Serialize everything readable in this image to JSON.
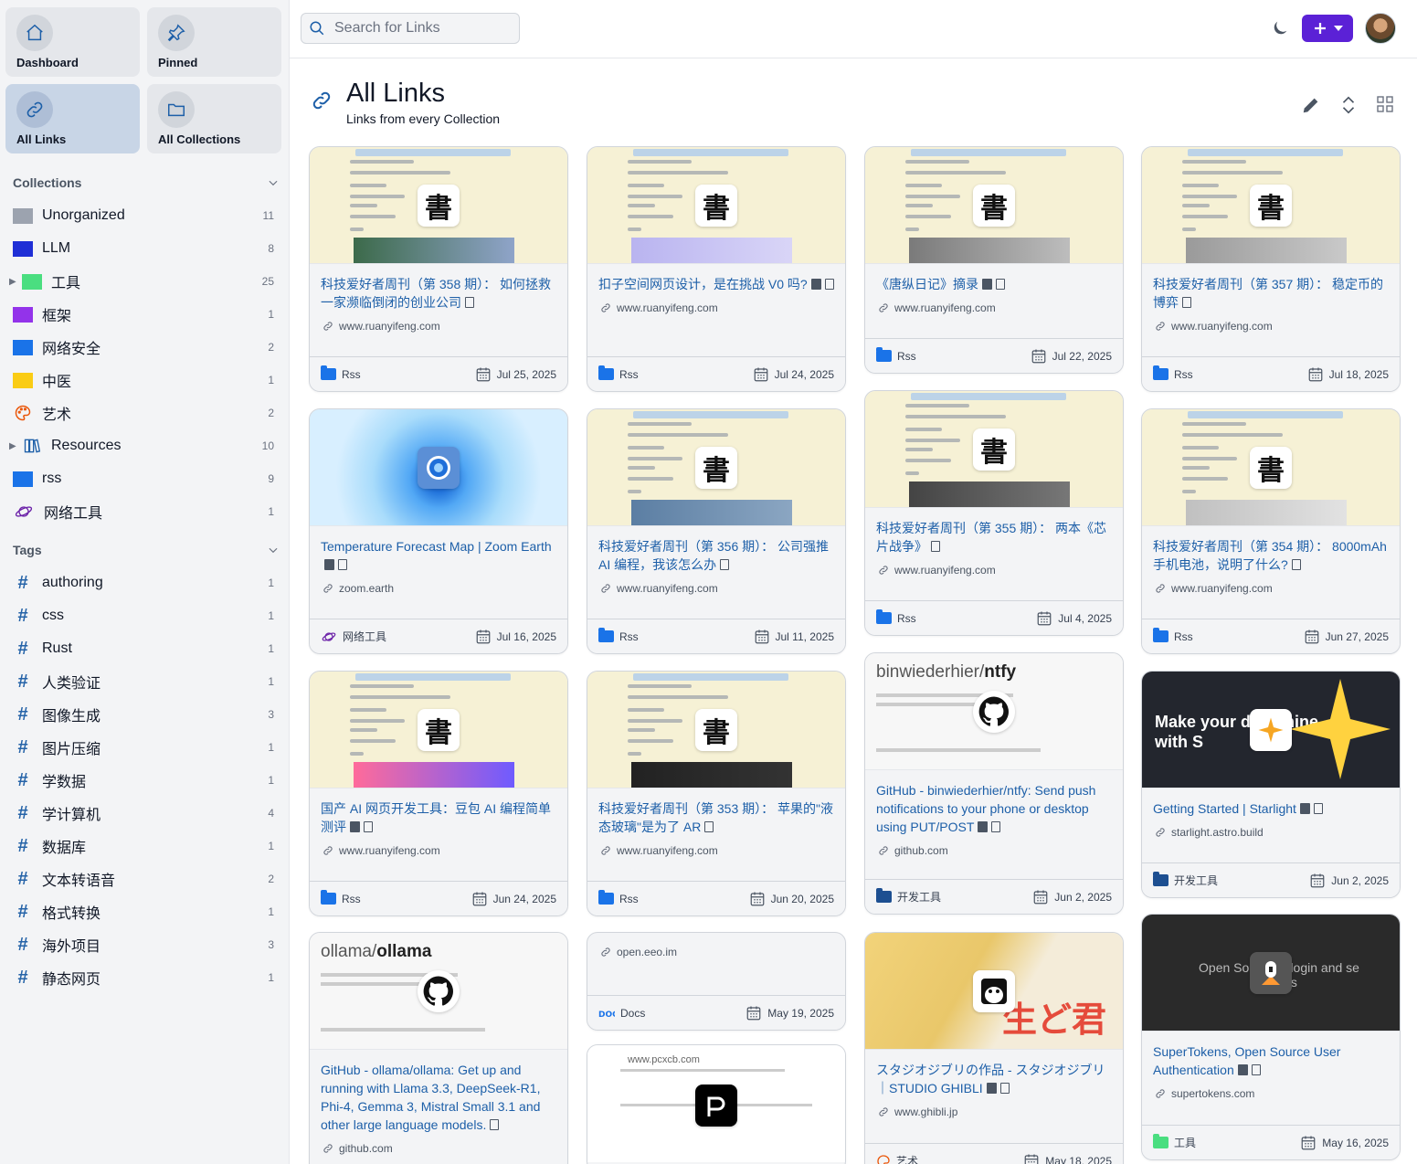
{
  "nav": [
    {
      "label": "Dashboard",
      "icon": "home-icon",
      "active": false
    },
    {
      "label": "Pinned",
      "icon": "pin-icon",
      "active": false
    },
    {
      "label": "All Links",
      "icon": "link-icon",
      "active": true
    },
    {
      "label": "All Collections",
      "icon": "folder-icon",
      "active": false
    }
  ],
  "collections": {
    "heading": "Collections",
    "items": [
      {
        "name": "Unorganized",
        "count": "11",
        "color": "#9ca3af",
        "icon": "folder-icon"
      },
      {
        "name": "LLM",
        "count": "8",
        "color": "#1f2fd6",
        "icon": "folder-icon"
      },
      {
        "name": "工具",
        "count": "25",
        "color": "#4ade80",
        "icon": "folder-icon",
        "expandable": true
      },
      {
        "name": "框架",
        "count": "1",
        "color": "#9333ea",
        "icon": "folder-icon"
      },
      {
        "name": "网络安全",
        "count": "2",
        "color": "#1a73e8",
        "icon": "folder-icon"
      },
      {
        "name": "中医",
        "count": "1",
        "color": "#facc15",
        "icon": "folder-icon"
      },
      {
        "name": "艺术",
        "count": "2",
        "color": "#ea580c",
        "icon": "palette-icon"
      },
      {
        "name": "Resources",
        "count": "10",
        "color": "#1d5fa8",
        "icon": "books-icon",
        "expandable": true
      },
      {
        "name": "rss",
        "count": "9",
        "color": "#1a73e8",
        "icon": "folder-icon"
      },
      {
        "name": "网络工具",
        "count": "1",
        "color": "#6b21a8",
        "icon": "planet-icon"
      }
    ]
  },
  "tags": {
    "heading": "Tags",
    "items": [
      {
        "name": "authoring",
        "count": "1"
      },
      {
        "name": "css",
        "count": "1"
      },
      {
        "name": "Rust",
        "count": "1"
      },
      {
        "name": "人类验证",
        "count": "1"
      },
      {
        "name": "图像生成",
        "count": "3"
      },
      {
        "name": "图片压缩",
        "count": "1"
      },
      {
        "name": "学数据",
        "count": "1"
      },
      {
        "name": "学计算机",
        "count": "4"
      },
      {
        "name": "数据库",
        "count": "1"
      },
      {
        "name": "文本转语音",
        "count": "2"
      },
      {
        "name": "格式转换",
        "count": "1"
      },
      {
        "name": "海外项目",
        "count": "3"
      },
      {
        "name": "静态网页",
        "count": "1"
      }
    ]
  },
  "search": {
    "placeholder": "Search for Links"
  },
  "header": {
    "title": "All Links",
    "subtitle": "Links from every Collection"
  },
  "colors": {
    "accent": "#5b21d6",
    "link": "#1d5fa8",
    "active_nav": "#c8d5e6"
  },
  "cards": [
    {
      "title": "科技爱好者周刊（第 358 期）： 如何拯救一家濒临倒闭的创业公司",
      "url": "www.ruanyifeng.com",
      "collection": "Rss",
      "date": "Jul 25, 2025",
      "thumb": "paper",
      "icons": [
        "doc"
      ]
    },
    {
      "title": "扣子空间网页设计，是在挑战 V0 吗?",
      "url": "www.ruanyifeng.com",
      "collection": "Rss",
      "date": "Jul 24, 2025",
      "thumb": "paper",
      "icons": [
        "img",
        "doc"
      ]
    },
    {
      "title": "《唐纵日记》摘录",
      "url": "www.ruanyifeng.com",
      "collection": "Rss",
      "date": "Jul 22, 2025",
      "thumb": "paper",
      "icons": [
        "img",
        "doc"
      ]
    },
    {
      "title": "科技爱好者周刊（第 357 期）： 稳定币的博弈",
      "url": "www.ruanyifeng.com",
      "collection": "Rss",
      "date": "Jul 18, 2025",
      "thumb": "paper",
      "icons": [
        "doc"
      ]
    },
    {
      "title": "Temperature Forecast Map | Zoom Earth",
      "url": "zoom.earth",
      "collection": "网络工具",
      "date": "Jul 16, 2025",
      "thumb": "zoom",
      "icons": [
        "img",
        "doc"
      ]
    },
    {
      "title": "科技爱好者周刊（第 356 期）： 公司强推 AI 编程，我该怎么办",
      "url": "www.ruanyifeng.com",
      "collection": "Rss",
      "date": "Jul 11, 2025",
      "thumb": "paper",
      "icons": [
        "doc"
      ]
    },
    {
      "title": "科技爱好者周刊（第 355 期）： 两本《芯片战争》",
      "url": "www.ruanyifeng.com",
      "collection": "Rss",
      "date": "Jul 4, 2025",
      "thumb": "paper",
      "icons": [
        "doc"
      ]
    },
    {
      "title": "科技爱好者周刊（第 354 期）： 8000mAh 手机电池，说明了什么?",
      "url": "www.ruanyifeng.com",
      "collection": "Rss",
      "date": "Jun 27, 2025",
      "thumb": "paper",
      "icons": [
        "doc"
      ]
    },
    {
      "title": "国产 AI 网页开发工具：豆包 AI 编程简单测评",
      "url": "www.ruanyifeng.com",
      "collection": "Rss",
      "date": "Jun 24, 2025",
      "thumb": "paper",
      "icons": [
        "img",
        "doc"
      ]
    },
    {
      "title": "科技爱好者周刊（第 353 期）： 苹果的\"液态玻璃\"是为了 AR",
      "url": "www.ruanyifeng.com",
      "collection": "Rss",
      "date": "Jun 20, 2025",
      "thumb": "paper",
      "icons": [
        "doc"
      ]
    },
    {
      "title": "GitHub - binwiederhier/ntfy: Send push notifications to your phone or desktop using PUT/POST",
      "url": "github.com",
      "collection": "开发工具",
      "date": "Jun 2, 2025",
      "thumb": "github",
      "repo_owner": "binwiederhier/",
      "repo_name": "ntfy",
      "icons": [
        "img",
        "doc"
      ]
    },
    {
      "title": "Getting Started | Starlight",
      "url": "starlight.astro.build",
      "collection": "开发工具",
      "date": "Jun 2, 2025",
      "thumb": "starlight",
      "thumb_text": "Make your d     ht shine with S",
      "icons": [
        "img",
        "doc"
      ]
    },
    {
      "title": "GitHub - ollama/ollama: Get up and running with Llama 3.3, DeepSeek-R1, Phi-4, Gemma 3, Mistral Small 3.1 and other large language models.",
      "url": "github.com",
      "collection": "",
      "date": "",
      "thumb": "github",
      "repo_owner": "ollama/",
      "repo_name": "ollama",
      "icons": [
        "doc"
      ]
    },
    {
      "title": "",
      "url": "open.eeo.im",
      "collection": "Docs",
      "date": "May 19, 2025",
      "thumb": "none",
      "icons": []
    },
    {
      "title": "スタジオジブリの作品 - スタジオジブリ｜STUDIO GHIBLI",
      "url": "www.ghibli.jp",
      "collection": "艺术",
      "date": "May 18, 2025",
      "thumb": "ghibli",
      "thumb_text": "生ど君",
      "icons": [
        "img",
        "doc"
      ]
    },
    {
      "title": "SuperTokens, Open Source User Authentication",
      "url": "supertokens.com",
      "collection": "工具",
      "date": "May 16, 2025",
      "thumb": "supertokens",
      "thumb_text": "Open Sour     with login and se     ssions",
      "icons": [
        "img",
        "doc"
      ]
    },
    {
      "title": "",
      "url": "www.pcxcb.com",
      "collection": "",
      "date": "",
      "thumb": "pcxcb",
      "icons": []
    }
  ]
}
